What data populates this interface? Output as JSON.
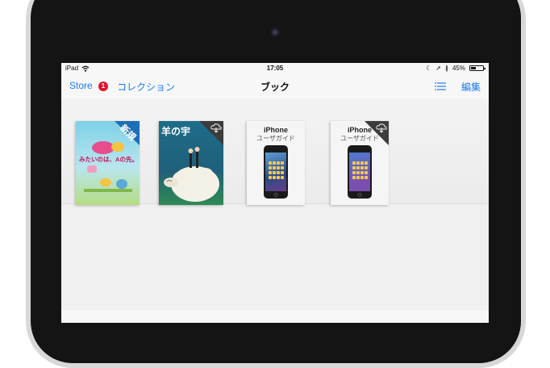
{
  "status_bar": {
    "device": "iPad",
    "time": "17:05",
    "battery": "45%",
    "battery_level": 0.45
  },
  "nav": {
    "store_label": "Store",
    "badge_count": "1",
    "collection_label": "コレクション",
    "title": "ブック",
    "edit_label": "編集"
  },
  "books": [
    {
      "cover_tag": "新規",
      "subtitle": "みたいのは、Aの先。",
      "cloud": false
    },
    {
      "title": "羊の宇",
      "cloud": true
    },
    {
      "title": "iPhone",
      "subtitle": "ユーザガイド",
      "cloud": false
    },
    {
      "title": "iPhone",
      "subtitle": "ユーザガイド",
      "cloud": true
    }
  ],
  "colors": {
    "accent": "#1c7cf3",
    "badge": "#e2142c",
    "frame": "#141414"
  }
}
